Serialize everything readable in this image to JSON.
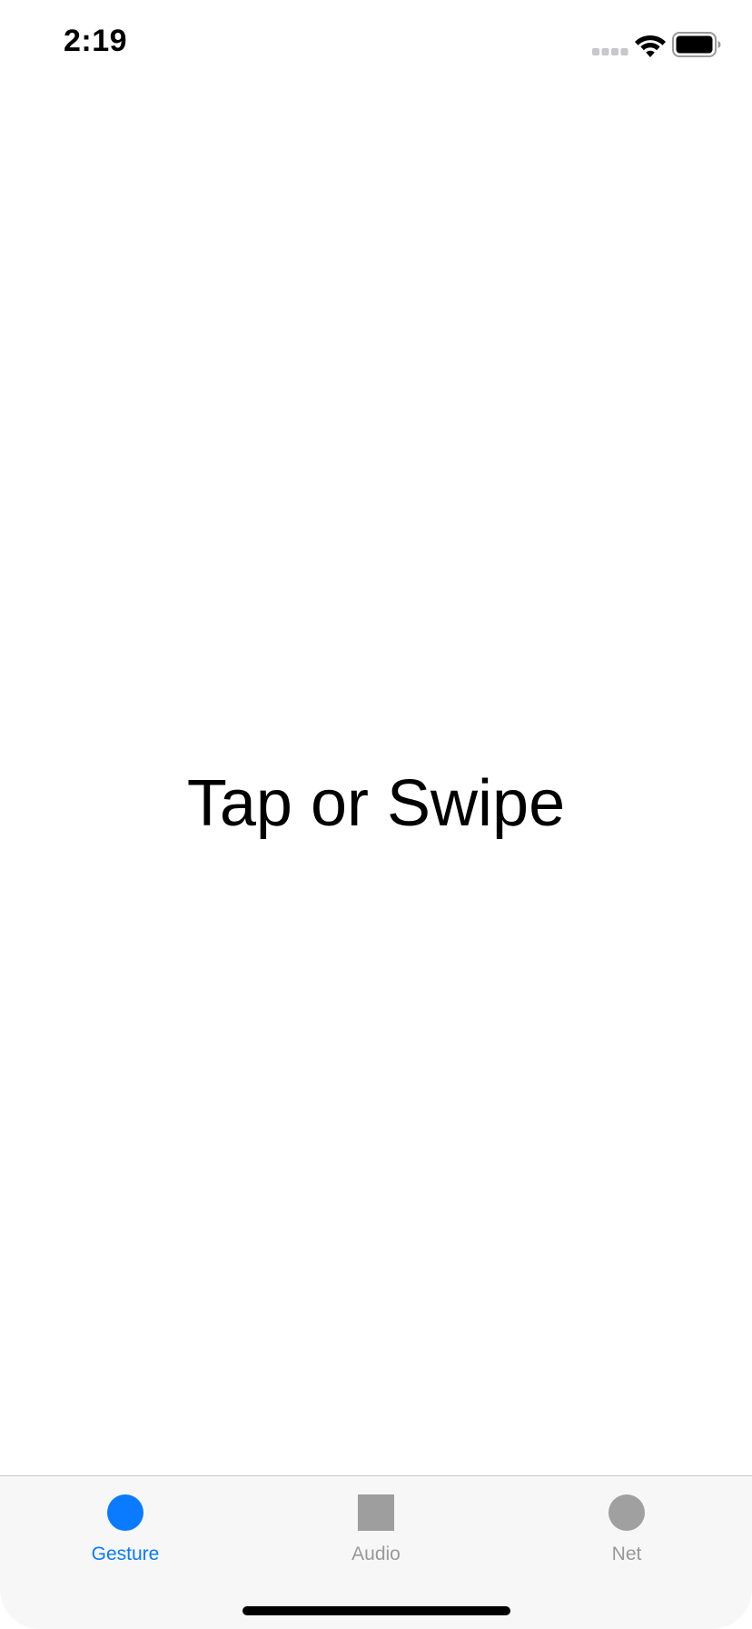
{
  "status_bar": {
    "time": "2:19",
    "signal_icon": "cellular-signal-icon",
    "wifi_icon": "wifi-icon",
    "battery_icon": "battery-icon"
  },
  "main": {
    "prompt": "Tap or Swipe"
  },
  "tab_bar": {
    "selected_index": 0,
    "active_color": "#0a7aff",
    "inactive_color": "#999999",
    "tabs": [
      {
        "label": "Gesture",
        "icon": "filled-circle-icon",
        "selected": true
      },
      {
        "label": "Audio",
        "icon": "filled-square-icon",
        "selected": false
      },
      {
        "label": "Net",
        "icon": "filled-circle-icon",
        "selected": false
      }
    ]
  }
}
